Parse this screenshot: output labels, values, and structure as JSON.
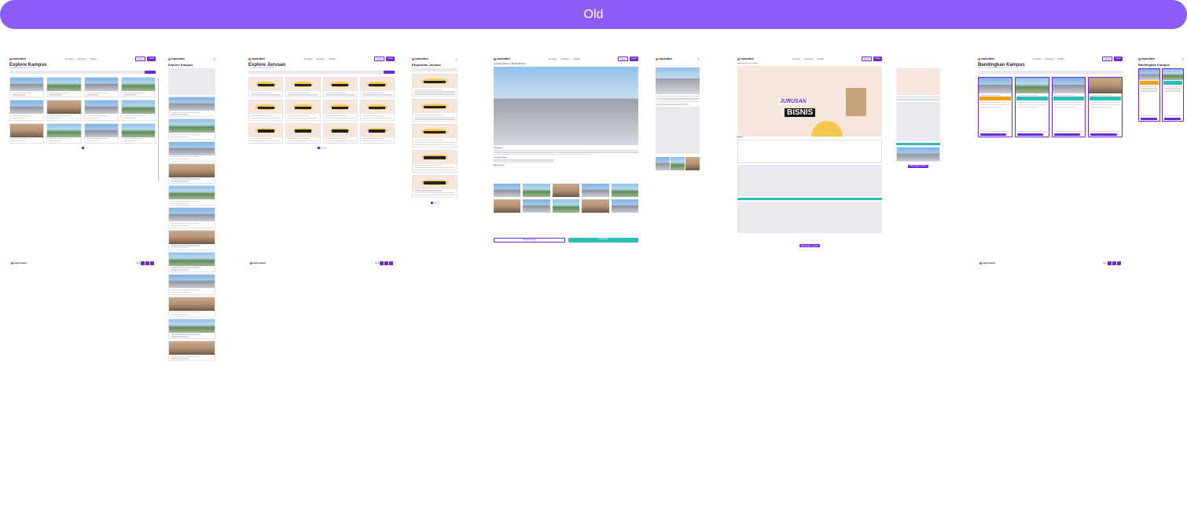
{
  "banner": {
    "label": "Old"
  },
  "nav": {
    "logo": "exploration",
    "links": [
      "Jurusan",
      "Kampus",
      "Artikel"
    ],
    "masuk": "Masuk",
    "daftar": "Daftar"
  },
  "frames": {
    "explore_kampus": {
      "title": "Explore Kampus",
      "subtitle": "Temukan kampus impianmu di sini"
    },
    "explore_kampus_mobile": {
      "title": "Explore Kampus"
    },
    "explore_jurusan": {
      "title": "Explore Jurusan",
      "subtitle": "Temukan jurusan impianmu di sini"
    },
    "explorasi_jurusan": {
      "title": "Eksplorasi Jurusan"
    },
    "campus_detail": {
      "breadcrumb": "exploration/kampus • BINUS @Bekasi",
      "section_pengantar": "Pengantar",
      "section_jurusan": "Jurusan Populer",
      "section_biaya": "Biaya Kuliah",
      "cta_outline": "Simpan Kampus",
      "cta_fill": "Bandingkan"
    },
    "jurusan_detail": {
      "breadcrumb": "exploration/jurusan • bisnis",
      "hero_word1": "JURUSAN",
      "hero_word2": "BISNIS",
      "label": "Bisnis",
      "cta": "Bandingkan Jurusan"
    },
    "bandingkan": {
      "title": "Bandingkan Kampus",
      "subtitle": "Pilih dan bandingkan kampus impianmu"
    },
    "bandingkan_mobile": {
      "title": "Bandingkan Kampus"
    }
  },
  "footer": {
    "logo": "exploration",
    "faq": "FAQ"
  }
}
